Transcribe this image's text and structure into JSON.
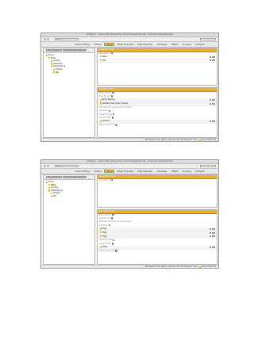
{
  "shot1": {
    "window_title": "Protégé 5 — Pizza (http://www.pizza.com/ontologies/pizza.owl) : [/Users/protege/pizza.owl]",
    "address": "Pizza (…)",
    "tabs": [
      {
        "label": "Active Ontology",
        "active": false
      },
      {
        "label": "Entities",
        "active": false
      },
      {
        "label": "Classes",
        "active": true
      },
      {
        "label": "Object Properties",
        "active": false
      },
      {
        "label": "Data Properties",
        "active": false
      },
      {
        "label": "Individuals",
        "active": false
      },
      {
        "label": "OWLViz",
        "active": false
      },
      {
        "label": "DL Query",
        "active": false
      },
      {
        "label": "OntoGraf",
        "active": false
      }
    ],
    "left_tabs": [
      "Class hierarchy",
      "Class hierarchy (inferred)"
    ],
    "tree": [
      {
        "label": "Thing",
        "depth": 0,
        "selected": false
      },
      {
        "label": "Pizza",
        "depth": 1,
        "selected": false
      },
      {
        "label": "Country",
        "depth": 2,
        "selected": false
      },
      {
        "label": "IceCream",
        "depth": 2,
        "selected": false
      },
      {
        "label": "PizzaTopping",
        "depth": 2,
        "selected": false
      },
      {
        "label": "Cheese",
        "depth": 3,
        "selected": false
      },
      {
        "label": "Hot",
        "depth": 3,
        "selected": true
      }
    ],
    "top_panel": {
      "header": "Annotations: Hot",
      "add_label": "Annotations",
      "items": [
        "label",
        "Hot"
      ]
    },
    "desc_panel": {
      "header": "Description: Hot",
      "rows": [
        "Equivalent To",
        "SubClass Of"
      ],
      "subclass_items": [
        "SpicyTopping",
        "hasSpiciness some Cheese"
      ],
      "more_rows": [
        "SubClass Of (Anonymous Ancestor)",
        "Instances",
        "Target for Key",
        "Disjoint With"
      ],
      "disjoint_items": [
        "Cheese"
      ],
      "tail_rows": [
        "Disjoint Union Of"
      ]
    },
    "status": "No Reasoner set. Select a reasoner from the Reasoner menu",
    "status_right": "Show Inferences"
  },
  "shot2": {
    "window_title": "Protégé 5 — Pizza (http://www.pizza.com/ontologies/pizza.owl) : [/Users/protege/pizza.owl]",
    "address": "Pizza (…)",
    "tabs": [
      {
        "label": "Active Ontology",
        "active": false
      },
      {
        "label": "Entities",
        "active": false
      },
      {
        "label": "Classes",
        "active": true
      },
      {
        "label": "Object Properties",
        "active": false
      },
      {
        "label": "Data Properties",
        "active": false
      },
      {
        "label": "Individuals",
        "active": false
      },
      {
        "label": "OWLViz",
        "active": false
      },
      {
        "label": "DL Query",
        "active": false
      },
      {
        "label": "OntoGraf",
        "active": false
      }
    ],
    "left_tabs": [
      "Class hierarchy",
      "Class hierarchy (inferred)"
    ],
    "tree": [
      {
        "label": "Thing",
        "depth": 0,
        "selected": false
      },
      {
        "label": "Pizza",
        "depth": 1,
        "selected": true
      },
      {
        "label": "Country",
        "depth": 1,
        "selected": false
      },
      {
        "label": "PizzaTopping",
        "depth": 1,
        "selected": false
      },
      {
        "label": "Cheese",
        "depth": 2,
        "selected": false
      },
      {
        "label": "Hot",
        "depth": 2,
        "selected": false
      }
    ],
    "top_panel": {
      "header": "Annotations: Pizza",
      "add_label": "Annotations",
      "items": []
    },
    "desc_panel": {
      "header": "Description: Pizza",
      "rows": [
        "Equivalent To",
        "SubClass Of",
        "SubClass Of (Anonymous Ancestor)"
      ],
      "subclass_items": [],
      "more_rows": [
        "Instances"
      ],
      "instance_items": [
        "High",
        "High",
        "High"
      ],
      "extra_rows": [
        "Target for Key",
        "Disjoint With"
      ],
      "disjoint_items": [
        "Pizza"
      ],
      "tail_rows": [
        "Disjoint Union Of"
      ]
    },
    "status": "No Reasoner set. Select a reasoner from the Reasoner menu",
    "status_right": "Show Inferences"
  }
}
